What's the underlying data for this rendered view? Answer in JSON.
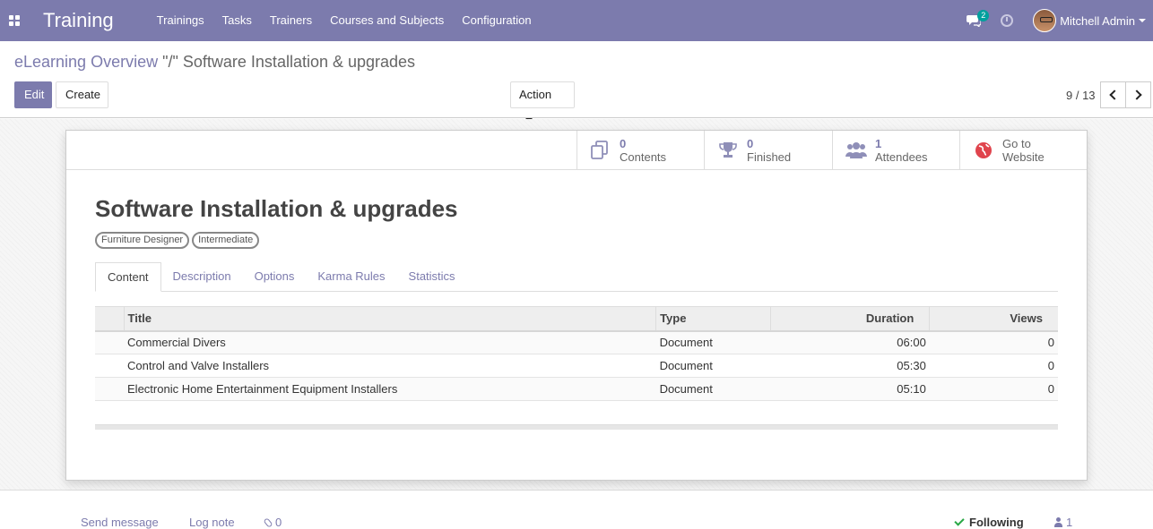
{
  "navbar": {
    "app_name": "Training",
    "menu": [
      "Trainings",
      "Tasks",
      "Trainers",
      "Courses and Subjects",
      "Configuration"
    ],
    "chat_count": "2",
    "user_name": "Mitchell Admin"
  },
  "breadcrumb": {
    "parent": "eLearning Overview",
    "separator": " \"/\" ",
    "current": "Software Installation & upgrades"
  },
  "toolbar": {
    "edit_label": "Edit",
    "create_label": "Create",
    "action_label": "Action"
  },
  "pager": {
    "value": "9 / 13"
  },
  "smart_buttons": [
    {
      "icon": "copy-icon",
      "count": "0",
      "label": "Contents"
    },
    {
      "icon": "trophy-icon",
      "count": "0",
      "label": "Finished"
    },
    {
      "icon": "users-icon",
      "count": "1",
      "label": "Attendees"
    },
    {
      "icon": "globe-icon",
      "line1": "Go to",
      "line2": "Website"
    }
  ],
  "record": {
    "title": "Software Installation & upgrades",
    "tags": [
      "Furniture Designer",
      "Intermediate"
    ]
  },
  "tabs": [
    "Content",
    "Description",
    "Options",
    "Karma Rules",
    "Statistics"
  ],
  "table": {
    "headers": {
      "title": "Title",
      "type": "Type",
      "duration": "Duration",
      "views": "Views"
    },
    "rows": [
      {
        "title": "Commercial Divers",
        "type": "Document",
        "duration": "06:00",
        "views": "0"
      },
      {
        "title": "Control and Valve Installers",
        "type": "Document",
        "duration": "05:30",
        "views": "0"
      },
      {
        "title": "Electronic Home Entertainment Equipment Installers",
        "type": "Document",
        "duration": "05:10",
        "views": "0"
      }
    ]
  },
  "chatter": {
    "send_message": "Send message",
    "log_note": "Log note",
    "attachments": "0",
    "following": "Following",
    "followers": "1"
  },
  "colors": {
    "primary": "#7c7bad",
    "teal": "#00a09d",
    "success": "#28a745"
  }
}
